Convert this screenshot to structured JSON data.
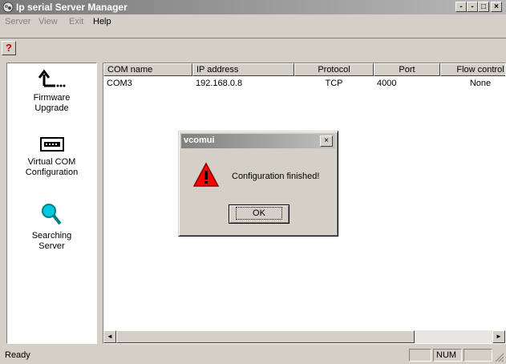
{
  "window": {
    "title": "Ip serial Server Manager",
    "caption_buttons": [
      "-",
      "□",
      "×"
    ],
    "mdi_buttons": [
      "-",
      "□",
      "×"
    ]
  },
  "menu": {
    "items": [
      {
        "label": "Server",
        "enabled": false
      },
      {
        "label": "View",
        "enabled": false
      },
      {
        "label": "Exit",
        "enabled": false
      },
      {
        "label": "Help",
        "enabled": true
      }
    ]
  },
  "toolbar": {
    "help_icon": "question-mark-icon",
    "help_glyph": "?"
  },
  "sidebar": {
    "items": [
      {
        "label": "Firmware\nUpgrade",
        "icon": "upgrade-arrow-icon"
      },
      {
        "label": "Virtual COM\nConfiguration",
        "icon": "serial-port-icon"
      },
      {
        "label": "Searching\nServer",
        "icon": "magnifier-icon"
      }
    ]
  },
  "table": {
    "columns": [
      "COM name",
      "IP address",
      "Protocol",
      "Port",
      "Flow control"
    ],
    "rows": [
      [
        "COM3",
        "192.168.0.8",
        "TCP",
        "4000",
        "None"
      ]
    ]
  },
  "scrollbar": {
    "left_arrow": "◄",
    "right_arrow": "►"
  },
  "dialog": {
    "title": "vcomui",
    "message": "Configuration finished!",
    "ok_label": "OK",
    "close_glyph": "×",
    "icon": "warning-icon",
    "icon_glyph": "!"
  },
  "status": {
    "text": "Ready",
    "num_indicator": "NUM"
  },
  "colors": {
    "titlebar_inactive": "#808080",
    "window_face": "#d4d0c8",
    "warning_red": "#ff0000"
  }
}
